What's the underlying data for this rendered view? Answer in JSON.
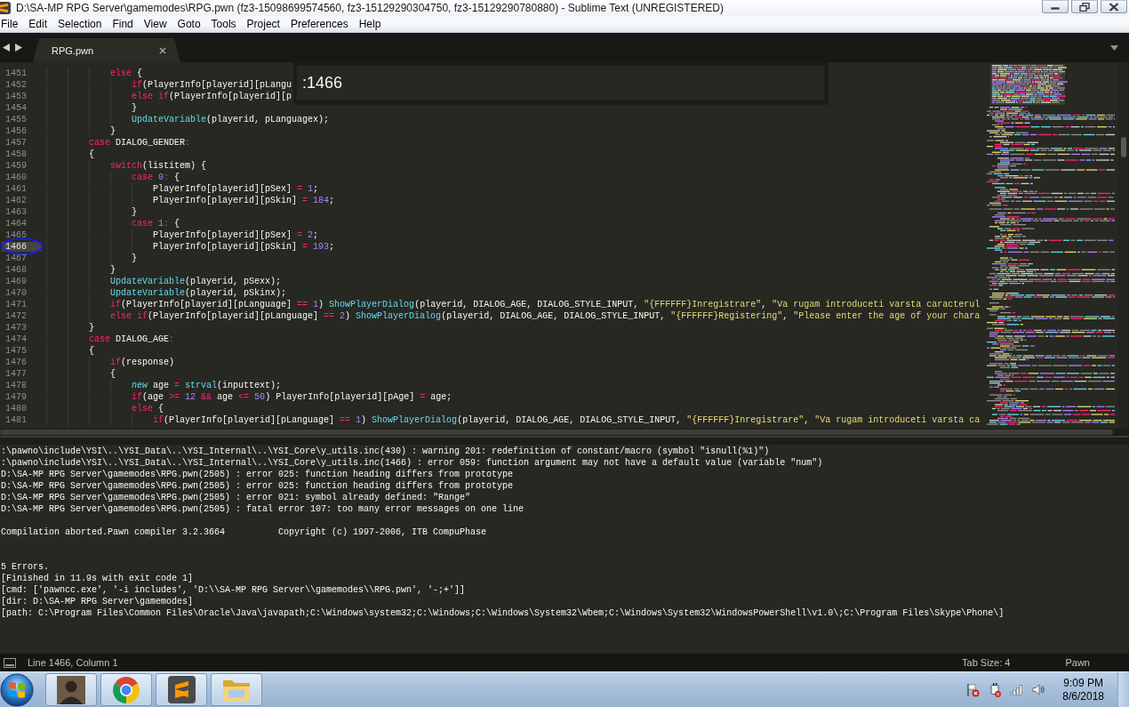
{
  "window": {
    "title": "D:\\SA-MP RPG Server\\gamemodes\\RPG.pwn (fz3-15098699574560, fz3-15129290304750, fz3-15129290780880) - Sublime Text (UNREGISTERED)"
  },
  "menu": [
    {
      "label": "File"
    },
    {
      "label": "Edit"
    },
    {
      "label": "Selection"
    },
    {
      "label": "Find"
    },
    {
      "label": "View"
    },
    {
      "label": "Goto"
    },
    {
      "label": "Tools"
    },
    {
      "label": "Project"
    },
    {
      "label": "Preferences"
    },
    {
      "label": "Help"
    }
  ],
  "tabs": [
    {
      "label": "RPG.pwn",
      "selected": true
    }
  ],
  "goto_panel": {
    "value": ":1466"
  },
  "editor": {
    "lines": [
      {
        "number": "1451",
        "current": false,
        "circled": false,
        "tokens": [
          {
            "kind": "keyword",
            "text": "            else"
          },
          {
            "kind": "plain",
            "text": " {"
          }
        ]
      },
      {
        "number": "1452",
        "current": false,
        "circled": false,
        "tokens": [
          {
            "kind": "keyword",
            "text": "                if"
          },
          {
            "kind": "plain",
            "text": "(PlayerInfo[playerid][pLangu"
          }
        ]
      },
      {
        "number": "1453",
        "current": false,
        "circled": false,
        "tokens": [
          {
            "kind": "keyword",
            "text": "                else if"
          },
          {
            "kind": "plain",
            "text": "(PlayerInfo[playerid][p"
          }
        ]
      },
      {
        "number": "1454",
        "current": false,
        "circled": false,
        "tokens": [
          {
            "kind": "plain",
            "text": "                }"
          }
        ]
      },
      {
        "number": "1455",
        "current": false,
        "circled": false,
        "tokens": [
          {
            "kind": "function",
            "text": "                UpdateVariable"
          },
          {
            "kind": "plain",
            "text": "(playerid, pLanguagex);"
          }
        ]
      },
      {
        "number": "1456",
        "current": false,
        "circled": false,
        "tokens": [
          {
            "kind": "plain",
            "text": "            }"
          }
        ]
      },
      {
        "number": "1457",
        "current": false,
        "circled": false,
        "tokens": [
          {
            "kind": "keyword",
            "text": "        case"
          },
          {
            "kind": "plain",
            "text": " DIALOG_GENDER"
          },
          {
            "kind": "keyword",
            "text": ":"
          }
        ]
      },
      {
        "number": "1458",
        "current": false,
        "circled": false,
        "tokens": [
          {
            "kind": "plain",
            "text": "        {"
          }
        ]
      },
      {
        "number": "1459",
        "current": false,
        "circled": false,
        "tokens": [
          {
            "kind": "keyword",
            "text": "            switch"
          },
          {
            "kind": "plain",
            "text": "(listitem) {"
          }
        ]
      },
      {
        "number": "1460",
        "current": false,
        "circled": false,
        "tokens": [
          {
            "kind": "keyword",
            "text": "                case "
          },
          {
            "kind": "number",
            "text": "0"
          },
          {
            "kind": "keyword",
            "text": ":"
          },
          {
            "kind": "plain",
            "text": " {"
          }
        ]
      },
      {
        "number": "1461",
        "current": false,
        "circled": false,
        "tokens": [
          {
            "kind": "plain",
            "text": "                    PlayerInfo[playerid][pSex] "
          },
          {
            "kind": "keyword",
            "text": "= "
          },
          {
            "kind": "number",
            "text": "1"
          },
          {
            "kind": "plain",
            "text": ";"
          }
        ]
      },
      {
        "number": "1462",
        "current": false,
        "circled": false,
        "tokens": [
          {
            "kind": "plain",
            "text": "                    PlayerInfo[playerid][pSkin] "
          },
          {
            "kind": "keyword",
            "text": "= "
          },
          {
            "kind": "number",
            "text": "184"
          },
          {
            "kind": "plain",
            "text": ";"
          }
        ]
      },
      {
        "number": "1463",
        "current": false,
        "circled": false,
        "tokens": [
          {
            "kind": "plain",
            "text": "                }"
          }
        ]
      },
      {
        "number": "1464",
        "current": false,
        "circled": false,
        "tokens": [
          {
            "kind": "keyword",
            "text": "                case "
          },
          {
            "kind": "number",
            "text": "1"
          },
          {
            "kind": "keyword",
            "text": ":"
          },
          {
            "kind": "plain",
            "text": " {"
          }
        ]
      },
      {
        "number": "1465",
        "current": false,
        "circled": false,
        "tokens": [
          {
            "kind": "plain",
            "text": "                    PlayerInfo[playerid][pSex] "
          },
          {
            "kind": "keyword",
            "text": "= "
          },
          {
            "kind": "number",
            "text": "2"
          },
          {
            "kind": "plain",
            "text": ";"
          }
        ]
      },
      {
        "number": "1466",
        "current": true,
        "circled": true,
        "tokens": [
          {
            "kind": "plain",
            "text": "                    PlayerInfo[playerid][pSkin] "
          },
          {
            "kind": "keyword",
            "text": "= "
          },
          {
            "kind": "number",
            "text": "193"
          },
          {
            "kind": "plain",
            "text": ";"
          }
        ]
      },
      {
        "number": "1467",
        "current": false,
        "circled": false,
        "tokens": [
          {
            "kind": "plain",
            "text": "                }"
          }
        ]
      },
      {
        "number": "1468",
        "current": false,
        "circled": false,
        "tokens": [
          {
            "kind": "plain",
            "text": "            }"
          }
        ]
      },
      {
        "number": "1469",
        "current": false,
        "circled": false,
        "tokens": [
          {
            "kind": "function",
            "text": "            UpdateVariable"
          },
          {
            "kind": "plain",
            "text": "(playerid, pSexx);"
          }
        ]
      },
      {
        "number": "1470",
        "current": false,
        "circled": false,
        "tokens": [
          {
            "kind": "function",
            "text": "            UpdateVariable"
          },
          {
            "kind": "plain",
            "text": "(playerid, pSkinx);"
          }
        ]
      },
      {
        "number": "1471",
        "current": false,
        "circled": false,
        "tokens": [
          {
            "kind": "keyword",
            "text": "            if"
          },
          {
            "kind": "plain",
            "text": "(PlayerInfo[playerid][pLanguage] "
          },
          {
            "kind": "keyword",
            "text": "== "
          },
          {
            "kind": "number",
            "text": "1"
          },
          {
            "kind": "plain",
            "text": ") "
          },
          {
            "kind": "function",
            "text": "ShowPlayerDialog"
          },
          {
            "kind": "plain",
            "text": "(playerid, DIALOG_AGE, DIALOG_STYLE_INPUT, "
          },
          {
            "kind": "string",
            "text": "\"{FFFFFF}Inregistrare\""
          },
          {
            "kind": "plain",
            "text": ", "
          },
          {
            "kind": "string",
            "text": "\"Va rugam introduceti varsta caracterul"
          }
        ]
      },
      {
        "number": "1472",
        "current": false,
        "circled": false,
        "tokens": [
          {
            "kind": "keyword",
            "text": "            else if"
          },
          {
            "kind": "plain",
            "text": "(PlayerInfo[playerid][pLanguage] "
          },
          {
            "kind": "keyword",
            "text": "== "
          },
          {
            "kind": "number",
            "text": "2"
          },
          {
            "kind": "plain",
            "text": ") "
          },
          {
            "kind": "function",
            "text": "ShowPlayerDialog"
          },
          {
            "kind": "plain",
            "text": "(playerid, DIALOG_AGE, DIALOG_STYLE_INPUT, "
          },
          {
            "kind": "string",
            "text": "\"{FFFFFF}Registering\""
          },
          {
            "kind": "plain",
            "text": ", "
          },
          {
            "kind": "string",
            "text": "\"Please enter the age of your chara"
          }
        ]
      },
      {
        "number": "1473",
        "current": false,
        "circled": false,
        "tokens": [
          {
            "kind": "plain",
            "text": "        }"
          }
        ]
      },
      {
        "number": "1474",
        "current": false,
        "circled": false,
        "tokens": [
          {
            "kind": "keyword",
            "text": "        case"
          },
          {
            "kind": "plain",
            "text": " DIALOG_AGE"
          },
          {
            "kind": "keyword",
            "text": ":"
          }
        ]
      },
      {
        "number": "1475",
        "current": false,
        "circled": false,
        "tokens": [
          {
            "kind": "plain",
            "text": "        {"
          }
        ]
      },
      {
        "number": "1476",
        "current": false,
        "circled": false,
        "tokens": [
          {
            "kind": "keyword",
            "text": "            if"
          },
          {
            "kind": "plain",
            "text": "(response)"
          }
        ]
      },
      {
        "number": "1477",
        "current": false,
        "circled": false,
        "tokens": [
          {
            "kind": "plain",
            "text": "            {"
          }
        ]
      },
      {
        "number": "1478",
        "current": false,
        "circled": false,
        "tokens": [
          {
            "kind": "storage",
            "text": "                new"
          },
          {
            "kind": "plain",
            "text": " age "
          },
          {
            "kind": "keyword",
            "text": "= "
          },
          {
            "kind": "function",
            "text": "strval"
          },
          {
            "kind": "plain",
            "text": "(inputtext);"
          }
        ]
      },
      {
        "number": "1479",
        "current": false,
        "circled": false,
        "tokens": [
          {
            "kind": "keyword",
            "text": "                if"
          },
          {
            "kind": "plain",
            "text": "(age "
          },
          {
            "kind": "keyword",
            "text": ">= "
          },
          {
            "kind": "number",
            "text": "12"
          },
          {
            "kind": "keyword",
            "text": " && "
          },
          {
            "kind": "plain",
            "text": "age "
          },
          {
            "kind": "keyword",
            "text": "<= "
          },
          {
            "kind": "number",
            "text": "50"
          },
          {
            "kind": "plain",
            "text": ") PlayerInfo[playerid][pAge] "
          },
          {
            "kind": "keyword",
            "text": "= "
          },
          {
            "kind": "plain",
            "text": "age;"
          }
        ]
      },
      {
        "number": "1480",
        "current": false,
        "circled": false,
        "tokens": [
          {
            "kind": "keyword",
            "text": "                else"
          },
          {
            "kind": "plain",
            "text": " {"
          }
        ]
      },
      {
        "number": "1481",
        "current": false,
        "circled": false,
        "tokens": [
          {
            "kind": "keyword",
            "text": "                    if"
          },
          {
            "kind": "plain",
            "text": "(PlayerInfo[playerid][pLanguage] "
          },
          {
            "kind": "keyword",
            "text": "== "
          },
          {
            "kind": "number",
            "text": "1"
          },
          {
            "kind": "plain",
            "text": ") "
          },
          {
            "kind": "function",
            "text": "ShowPlayerDialog"
          },
          {
            "kind": "plain",
            "text": "(playerid, DIALOG_AGE, DIALOG_STYLE_INPUT, "
          },
          {
            "kind": "string",
            "text": "\"{FFFFFF}Inregistrare\""
          },
          {
            "kind": "plain",
            "text": ", "
          },
          {
            "kind": "string",
            "text": "\"Va rugam introduceti varsta ca"
          }
        ]
      }
    ]
  },
  "output": {
    "blocks": [
      {
        "lines": [
          ":\\pawno\\include\\YSI\\..\\YSI_Data\\..\\YSI_Internal\\..\\YSI_Core\\y_utils.inc(430) : warning 201: redefinition of constant/macro (symbol \"isnull(%1)\")",
          ":\\pawno\\include\\YSI\\..\\YSI_Data\\..\\YSI_Internal\\..\\YSI_Core\\y_utils.inc(1466) : error 059: function argument may not have a default value (variable \"num\")",
          "D:\\SA-MP RPG Server\\gamemodes\\RPG.pwn(2505) : error 025: function heading differs from prototype",
          "D:\\SA-MP RPG Server\\gamemodes\\RPG.pwn(2505) : error 025: function heading differs from prototype",
          "D:\\SA-MP RPG Server\\gamemodes\\RPG.pwn(2505) : error 021: symbol already defined: \"Range\"",
          "D:\\SA-MP RPG Server\\gamemodes\\RPG.pwn(2505) : fatal error 107: too many error messages on one line"
        ]
      },
      {
        "lines": [
          "Compilation aborted.Pawn compiler 3.2.3664          Copyright (c) 1997-2006, ITB CompuPhase"
        ]
      },
      {
        "lines": [
          "5 Errors.",
          "[Finished in 11.9s with exit code 1]",
          "[cmd: ['pawncc.exe', '-i includes', 'D:\\\\SA-MP RPG Server\\\\gamemodes\\\\RPG.pwn', '-;+']]",
          "[dir: D:\\SA-MP RPG Server\\gamemodes]",
          "[path: C:\\Program Files\\Common Files\\Oracle\\Java\\javapath;C:\\Windows\\system32;C:\\Windows;C:\\Windows\\System32\\Wbem;C:\\Windows\\System32\\WindowsPowerShell\\v1.0\\;C:\\Program Files\\Skype\\Phone\\]"
        ]
      }
    ]
  },
  "status_bar": {
    "position": "Line 1466, Column 1",
    "tab_size": "Tab Size: 4",
    "syntax": "Pawn"
  },
  "taskbar": {
    "time": "9:09 PM",
    "date": "8/6/2018"
  }
}
